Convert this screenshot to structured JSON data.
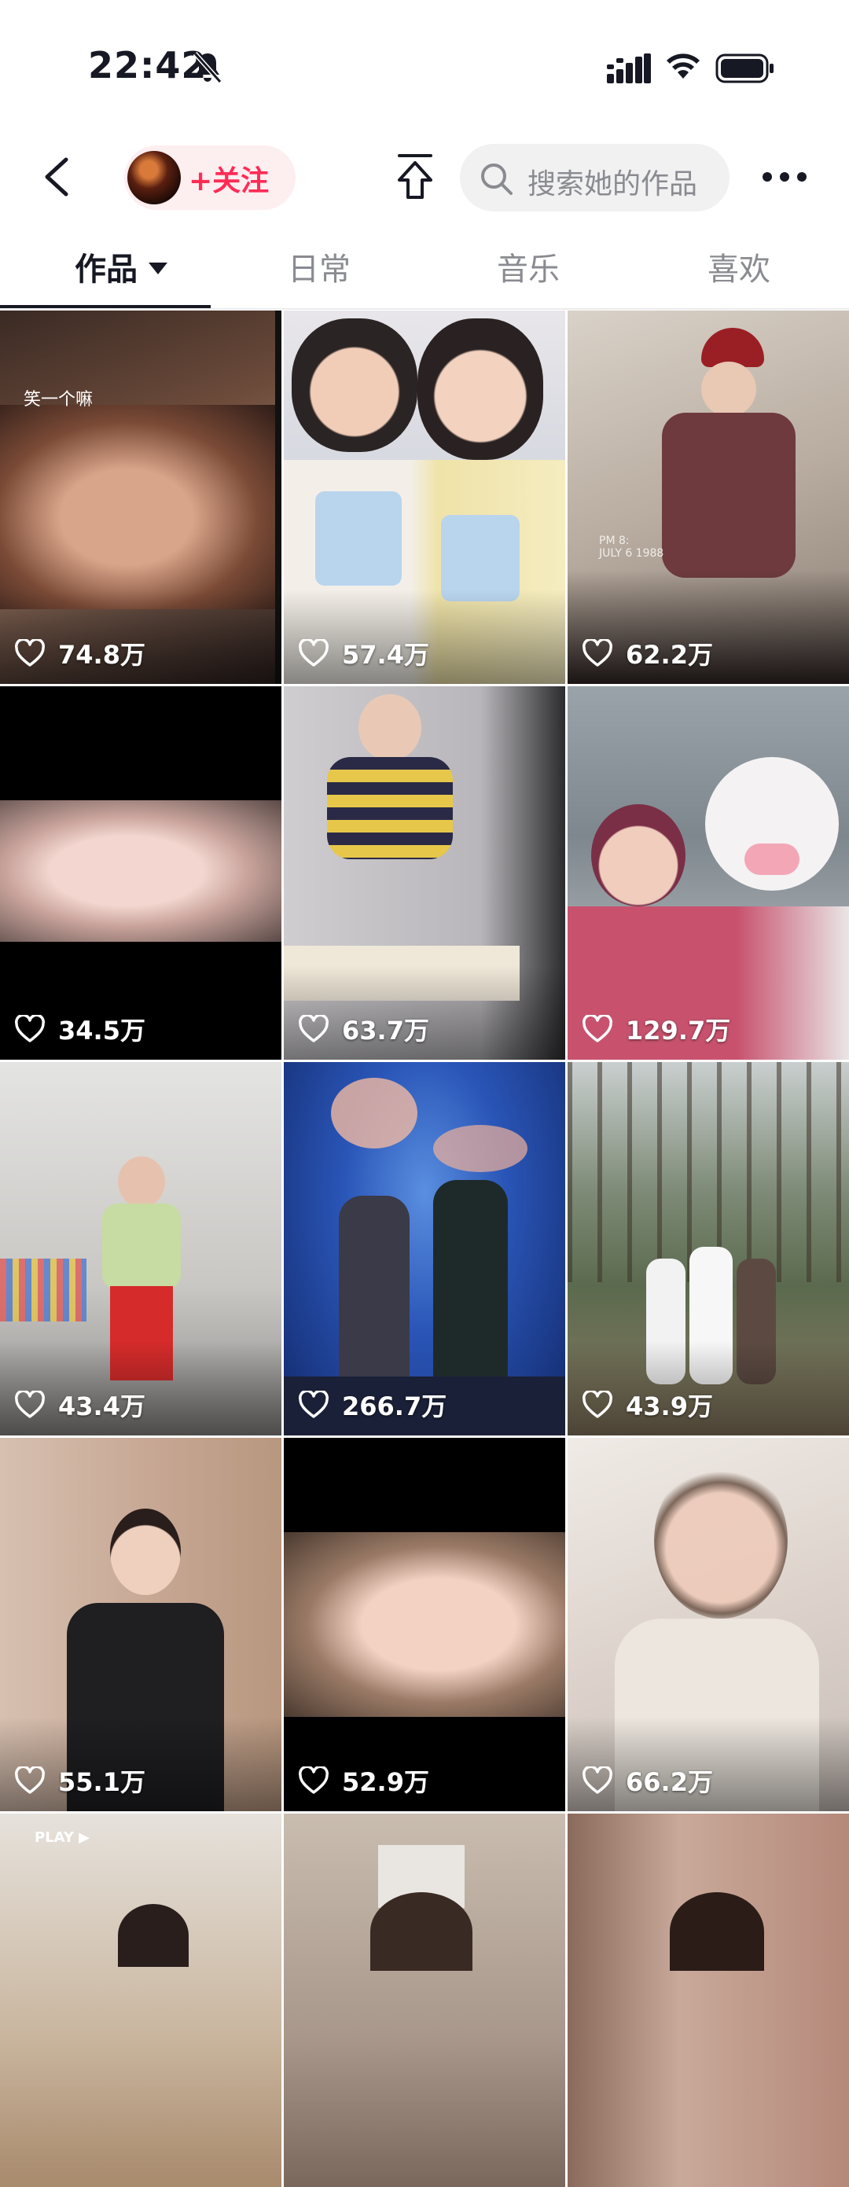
{
  "status_bar": {
    "time": "22:42"
  },
  "header": {
    "follow_label": "+关注",
    "search_placeholder": "搜索她的作品"
  },
  "tabs": [
    {
      "label": "作品",
      "active": true
    },
    {
      "label": "日常",
      "active": false
    },
    {
      "label": "音乐",
      "active": false
    },
    {
      "label": "喜欢",
      "active": false
    }
  ],
  "videos": [
    {
      "likes": "74.8万"
    },
    {
      "likes": "57.4万"
    },
    {
      "likes": "62.2万"
    },
    {
      "likes": "34.5万"
    },
    {
      "likes": "63.7万"
    },
    {
      "likes": "129.7万"
    },
    {
      "likes": "43.4万"
    },
    {
      "likes": "266.7万"
    },
    {
      "likes": "43.9万"
    },
    {
      "likes": "55.1万"
    },
    {
      "likes": "52.9万"
    },
    {
      "likes": "66.2万"
    }
  ],
  "thumbnail_overlays": {
    "tile1_caption": "笑一个嘛",
    "tile3_stamp_line1": "PM 8:",
    "tile3_stamp_line2": "JULY 6 1988",
    "tile13_badge": "PLAY ▶"
  },
  "colors": {
    "accent": "#fe2c55",
    "follow_bg": "#fdeef0",
    "text_primary": "#161823",
    "text_secondary": "#8a8b91"
  }
}
